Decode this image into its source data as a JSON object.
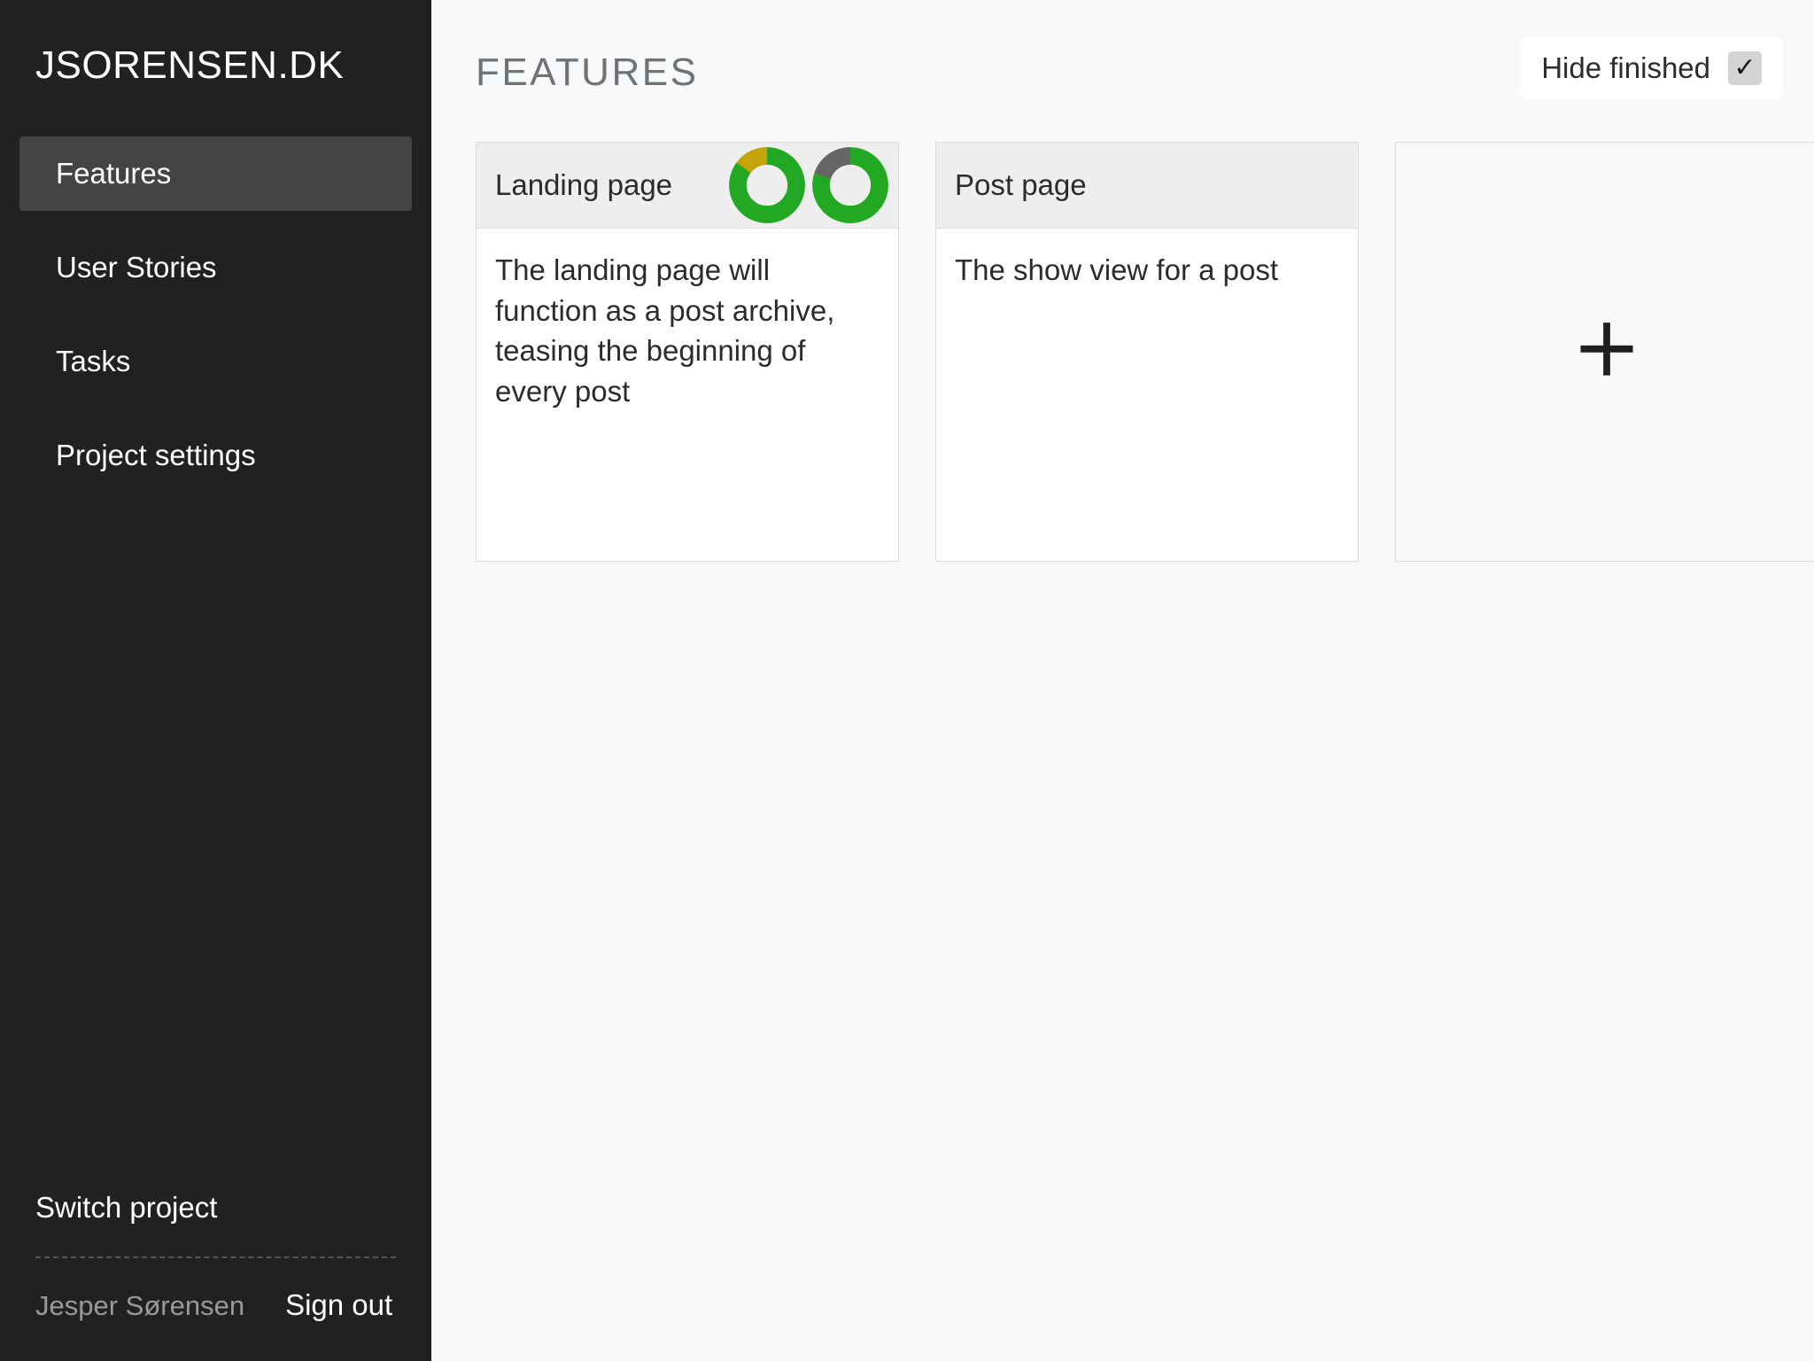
{
  "sidebar": {
    "brand": "JSORENSEN.DK",
    "items": [
      {
        "label": "Features",
        "active": true
      },
      {
        "label": "User Stories",
        "active": false
      },
      {
        "label": "Tasks",
        "active": false
      },
      {
        "label": "Project settings",
        "active": false
      }
    ],
    "switch_project": "Switch project",
    "user_name": "Jesper Sørensen",
    "sign_out": "Sign out"
  },
  "header": {
    "title": "FEATURES",
    "hide_finished_label": "Hide finished",
    "hide_finished_checked": true,
    "check_glyph": "✓"
  },
  "cards": [
    {
      "title": "Landing page",
      "description": "The landing page will function as a post archive, teasing the beginning of every post",
      "rings": [
        {
          "name": "progress-ring-1",
          "green_pct": 85,
          "second_pct": 15,
          "second_color": "#c4a408"
        },
        {
          "name": "progress-ring-2",
          "green_pct": 80,
          "second_pct": 20,
          "second_color": "#666666"
        }
      ]
    },
    {
      "title": "Post page",
      "description": "The show view for a post",
      "rings": []
    }
  ],
  "add_card": {
    "icon": "plus-icon",
    "glyph": "＋"
  },
  "colors": {
    "sidebar_bg": "#212121",
    "sidebar_active": "#444444",
    "main_bg": "#f7f8f9",
    "card_header_bg": "#eeeeee",
    "ring_green": "#23a823",
    "ring_amber": "#c4a408",
    "ring_gray": "#666666",
    "title_gray": "#6f7376"
  }
}
